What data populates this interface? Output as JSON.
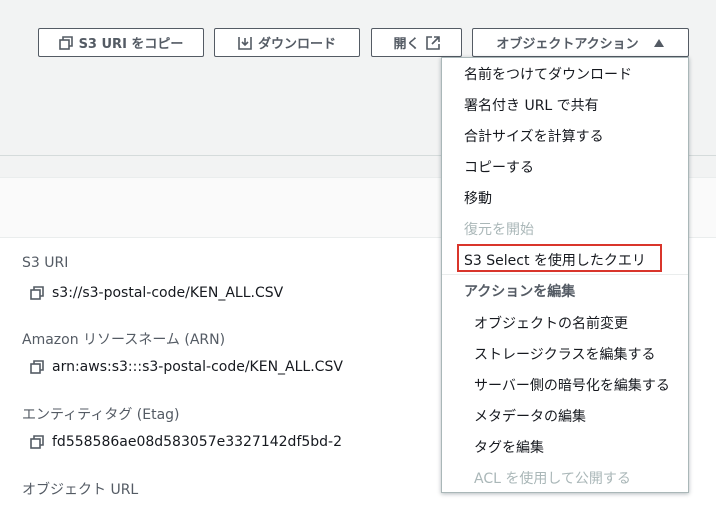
{
  "toolbar": {
    "copy_uri_label": "S3 URI をコピー",
    "download_label": "ダウンロード",
    "open_label": "開く",
    "actions_label": "オブジェクトアクション"
  },
  "details": {
    "s3_uri_label": "S3 URI",
    "s3_uri_value": "s3://s3-postal-code/KEN_ALL.CSV",
    "arn_label": "Amazon リソースネーム (ARN)",
    "arn_value": "arn:aws:s3:::s3-postal-code/KEN_ALL.CSV",
    "etag_label": "エンティティタグ (Etag)",
    "etag_value": "fd558586ae08d583057e3327142df5bd-2",
    "url_label": "オブジェクト URL"
  },
  "menu": {
    "download_as": "名前をつけてダウンロード",
    "share_presigned": "署名付き URL で共有",
    "calc_size": "合計サイズを計算する",
    "copy": "コピーする",
    "move": "移動",
    "start_restore": "復元を開始",
    "query_s3_select": "S3 Select を使用したクエリ",
    "edit_group": "アクションを編集",
    "rename": "オブジェクトの名前変更",
    "edit_storage_class": "ストレージクラスを編集する",
    "edit_sse": "サーバー側の暗号化を編集する",
    "edit_metadata": "メタデータの編集",
    "edit_tags": "タグを編集",
    "make_public_acl": "ACL を使用して公開する"
  },
  "colors": {
    "border": "#545b64",
    "highlight": "#d9352b",
    "disabled": "#aab7b8"
  }
}
